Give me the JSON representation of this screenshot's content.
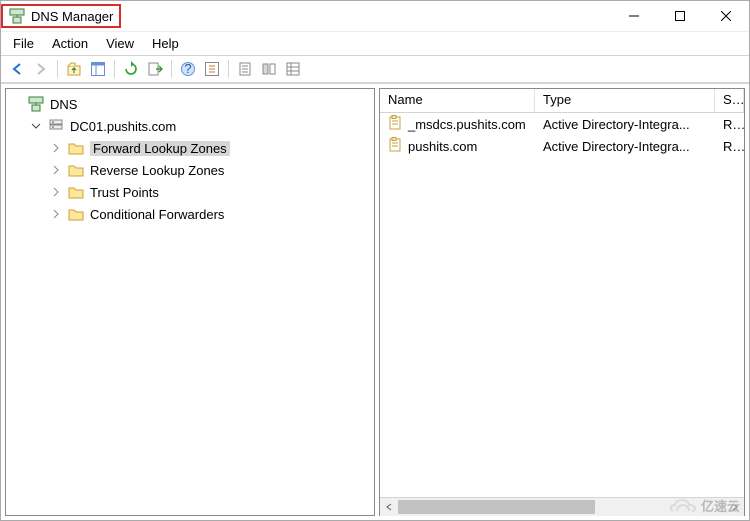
{
  "window": {
    "title": "DNS Manager"
  },
  "menu": {
    "file": "File",
    "action": "Action",
    "view": "View",
    "help": "Help"
  },
  "tree": {
    "root": "DNS",
    "server": "DC01.pushits.com",
    "nodes": {
      "fwd": "Forward Lookup Zones",
      "rev": "Reverse Lookup Zones",
      "trust": "Trust Points",
      "cond": "Conditional Forwarders"
    }
  },
  "list": {
    "cols": {
      "name": "Name",
      "type": "Type",
      "status": "Sta"
    },
    "rows": [
      {
        "name": "_msdcs.pushits.com",
        "type": "Active Directory-Integra...",
        "status": "Ru"
      },
      {
        "name": "pushits.com",
        "type": "Active Directory-Integra...",
        "status": "Ru"
      }
    ]
  },
  "watermark": "亿速云"
}
